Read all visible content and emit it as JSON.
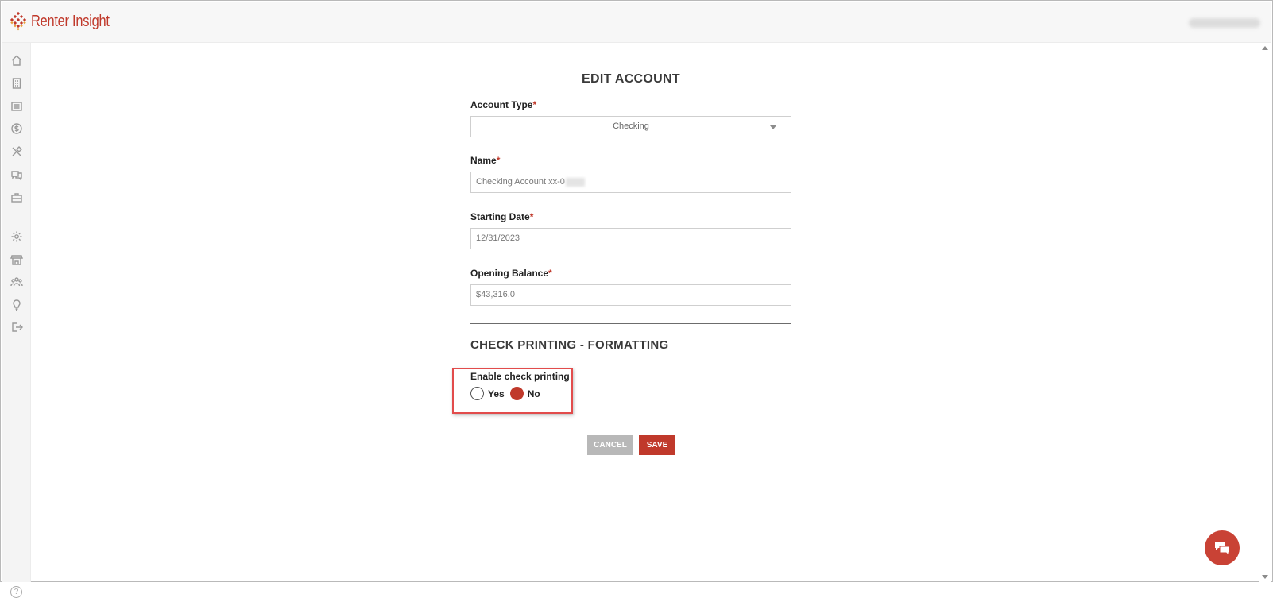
{
  "app": {
    "brand": "Renter Insight",
    "brand_color": "#c0392b"
  },
  "sidebar": {
    "items": [
      {
        "icon": "home-icon"
      },
      {
        "icon": "building-icon"
      },
      {
        "icon": "list-icon"
      },
      {
        "icon": "dollar-icon"
      },
      {
        "icon": "tools-icon"
      },
      {
        "icon": "chat-icon"
      },
      {
        "icon": "briefcase-icon"
      },
      {
        "icon": "gear-icon"
      },
      {
        "icon": "store-icon"
      },
      {
        "icon": "users-icon"
      },
      {
        "icon": "lightbulb-icon"
      },
      {
        "icon": "logout-icon"
      }
    ],
    "help_icon": "?"
  },
  "form": {
    "title": "EDIT ACCOUNT",
    "account_type": {
      "label": "Account Type",
      "required": "*",
      "value": "Checking"
    },
    "name": {
      "label": "Name",
      "required": "*",
      "value": "Checking Account xx-0"
    },
    "starting_date": {
      "label": "Starting Date",
      "required": "*",
      "value": "12/31/2023"
    },
    "opening_balance": {
      "label": "Opening Balance",
      "required": "*",
      "value": "$43,316.0"
    },
    "section_title": "CHECK PRINTING - FORMATTING",
    "enable_check_printing": {
      "label": "Enable check printing",
      "options": [
        "Yes",
        "No"
      ],
      "selected": "No"
    },
    "cancel_label": "CANCEL",
    "save_label": "SAVE"
  }
}
